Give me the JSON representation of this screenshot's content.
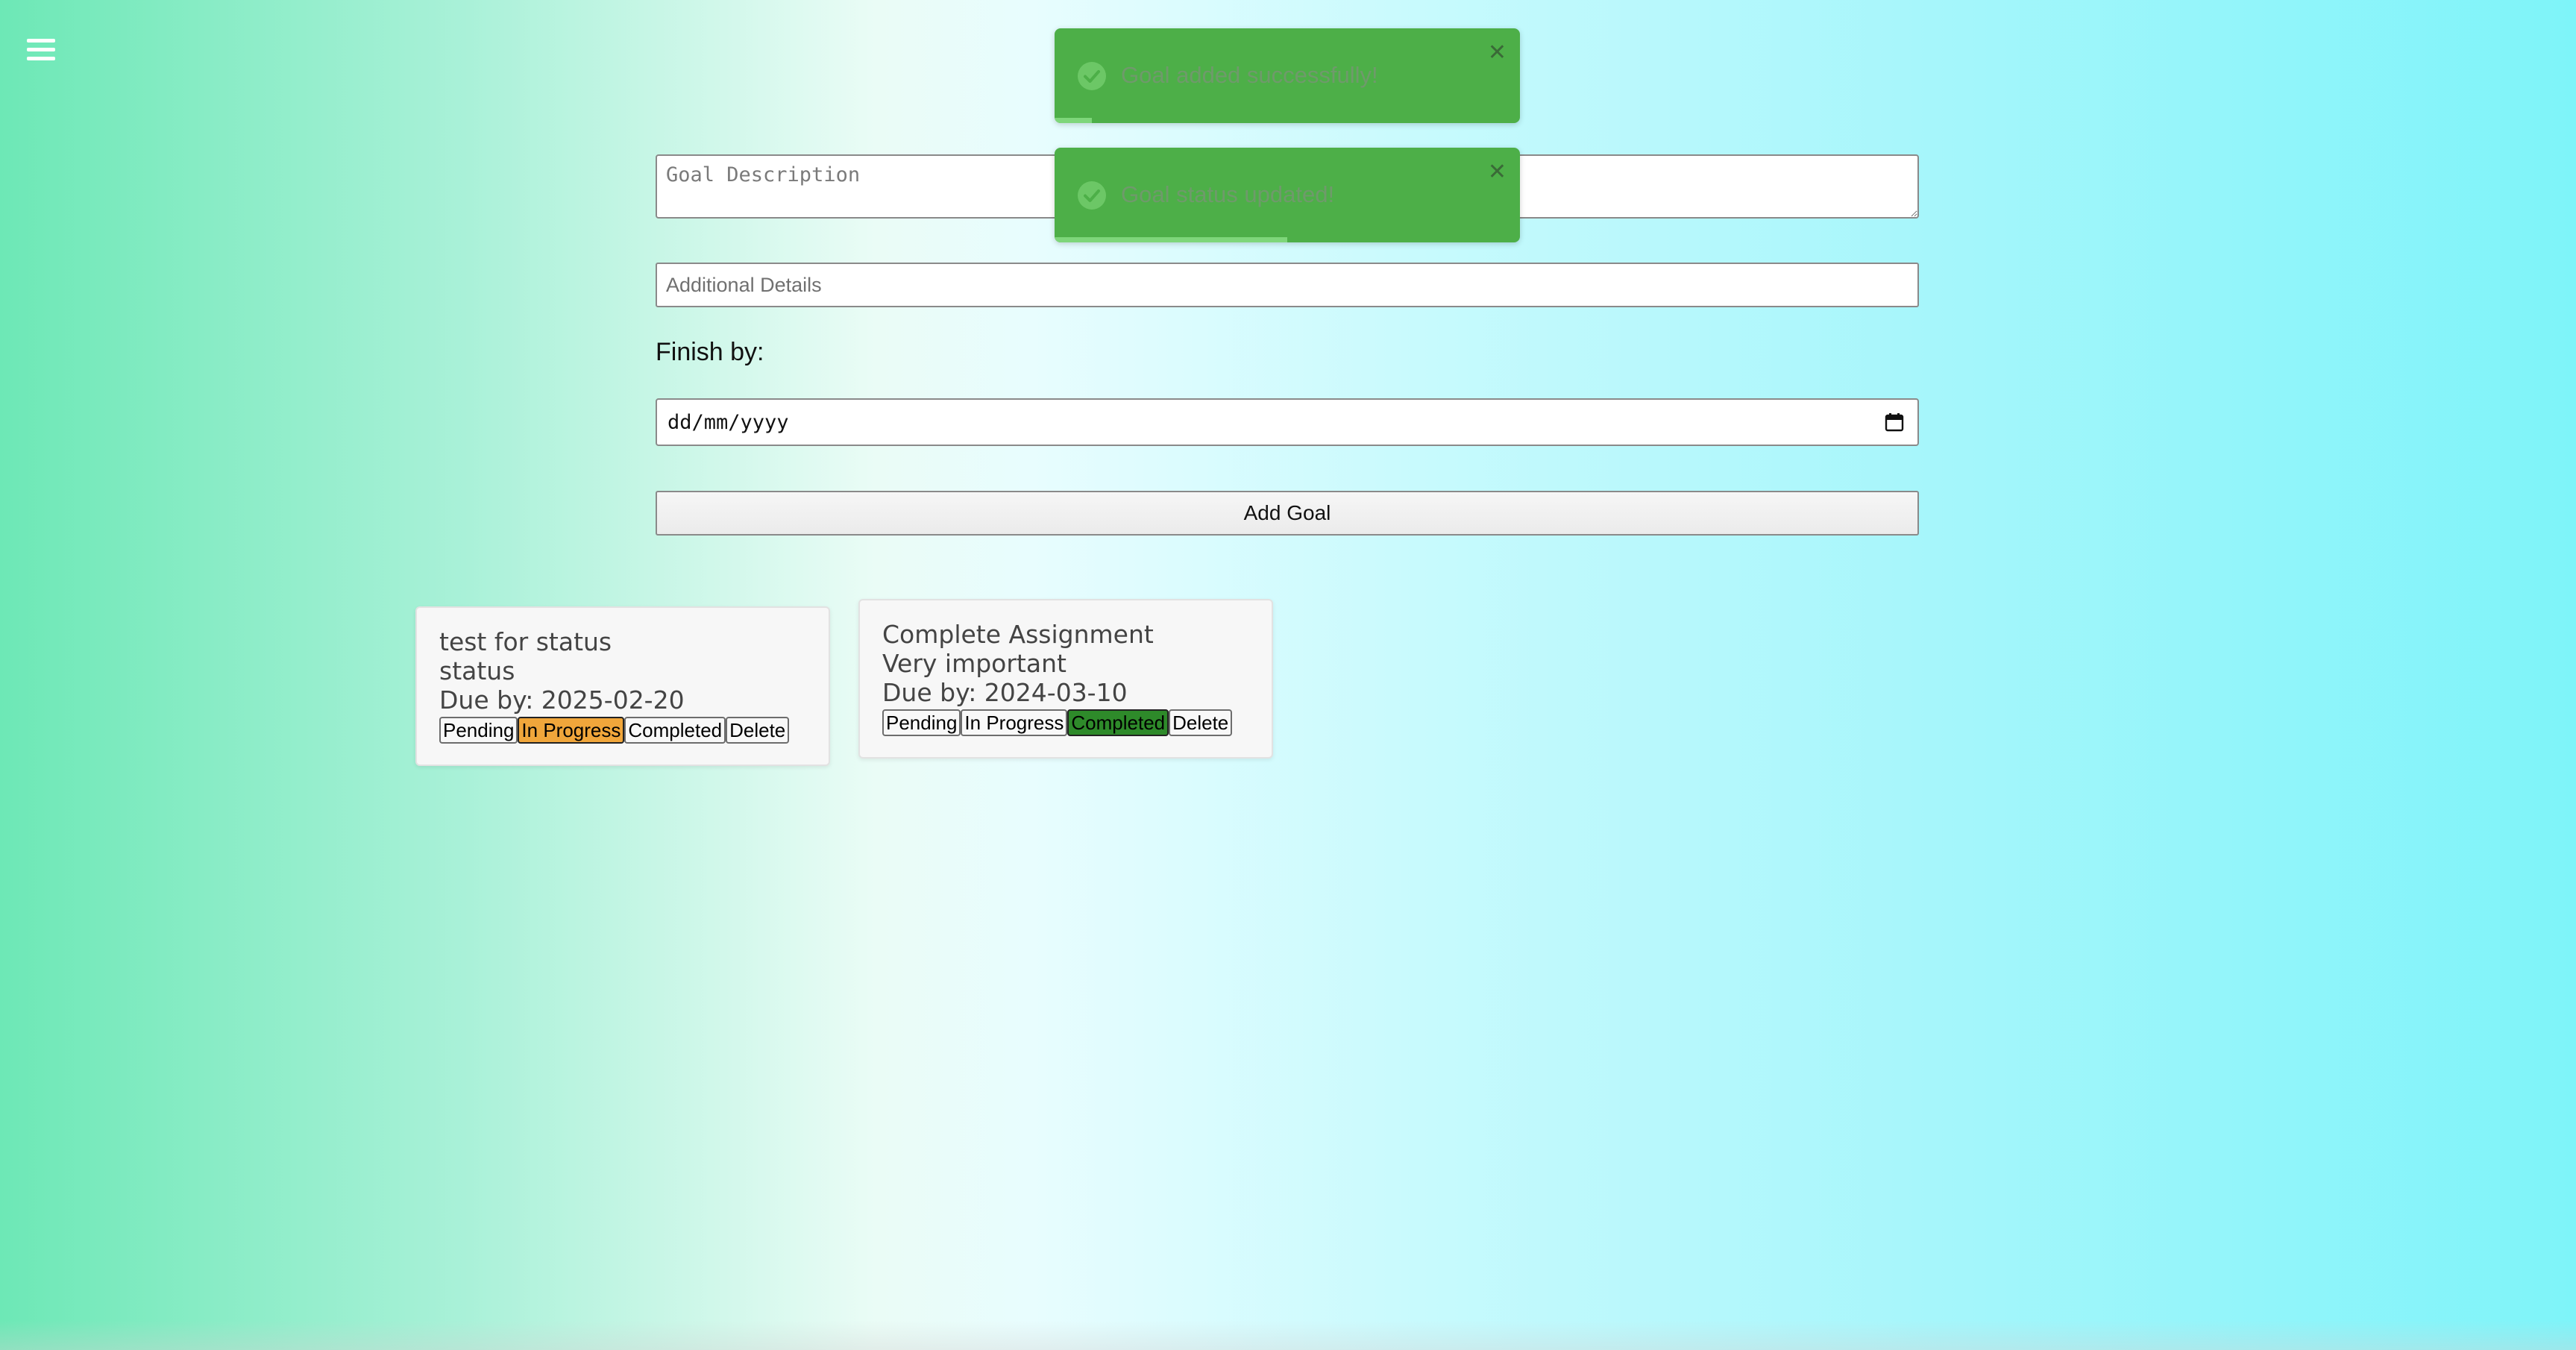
{
  "header": {
    "menu_icon": "hamburger-menu-icon"
  },
  "form": {
    "description_placeholder": "Goal Description",
    "details_placeholder": "Additional Details",
    "finish_label": "Finish by:",
    "date_placeholder": "dd/mm/yyyy",
    "date_icon": "calendar-icon",
    "add_button_label": "Add Goal"
  },
  "goals": [
    {
      "title": "test for status",
      "details": "status",
      "due": "Due by: 2025-02-20",
      "status": "In Progress",
      "buttons": [
        "Pending",
        "In Progress",
        "Completed",
        "Delete"
      ]
    },
    {
      "title": "Complete Assignment",
      "details": "Very important",
      "due": "Due by: 2024-03-10",
      "status": "Completed",
      "buttons": [
        "Pending",
        "In Progress",
        "Completed",
        "Delete"
      ]
    }
  ],
  "toasts": [
    {
      "message": "Goal added successfully!",
      "icon": "check-circle-icon",
      "close_icon": "close-icon",
      "progress": 0.08
    },
    {
      "message": "Goal status updated!",
      "icon": "check-circle-icon",
      "close_icon": "close-icon",
      "progress": 0.5
    }
  ],
  "colors": {
    "in_progress": "#f0a63b",
    "completed": "#2e8a2a",
    "toast_bg": "#4daf48"
  }
}
